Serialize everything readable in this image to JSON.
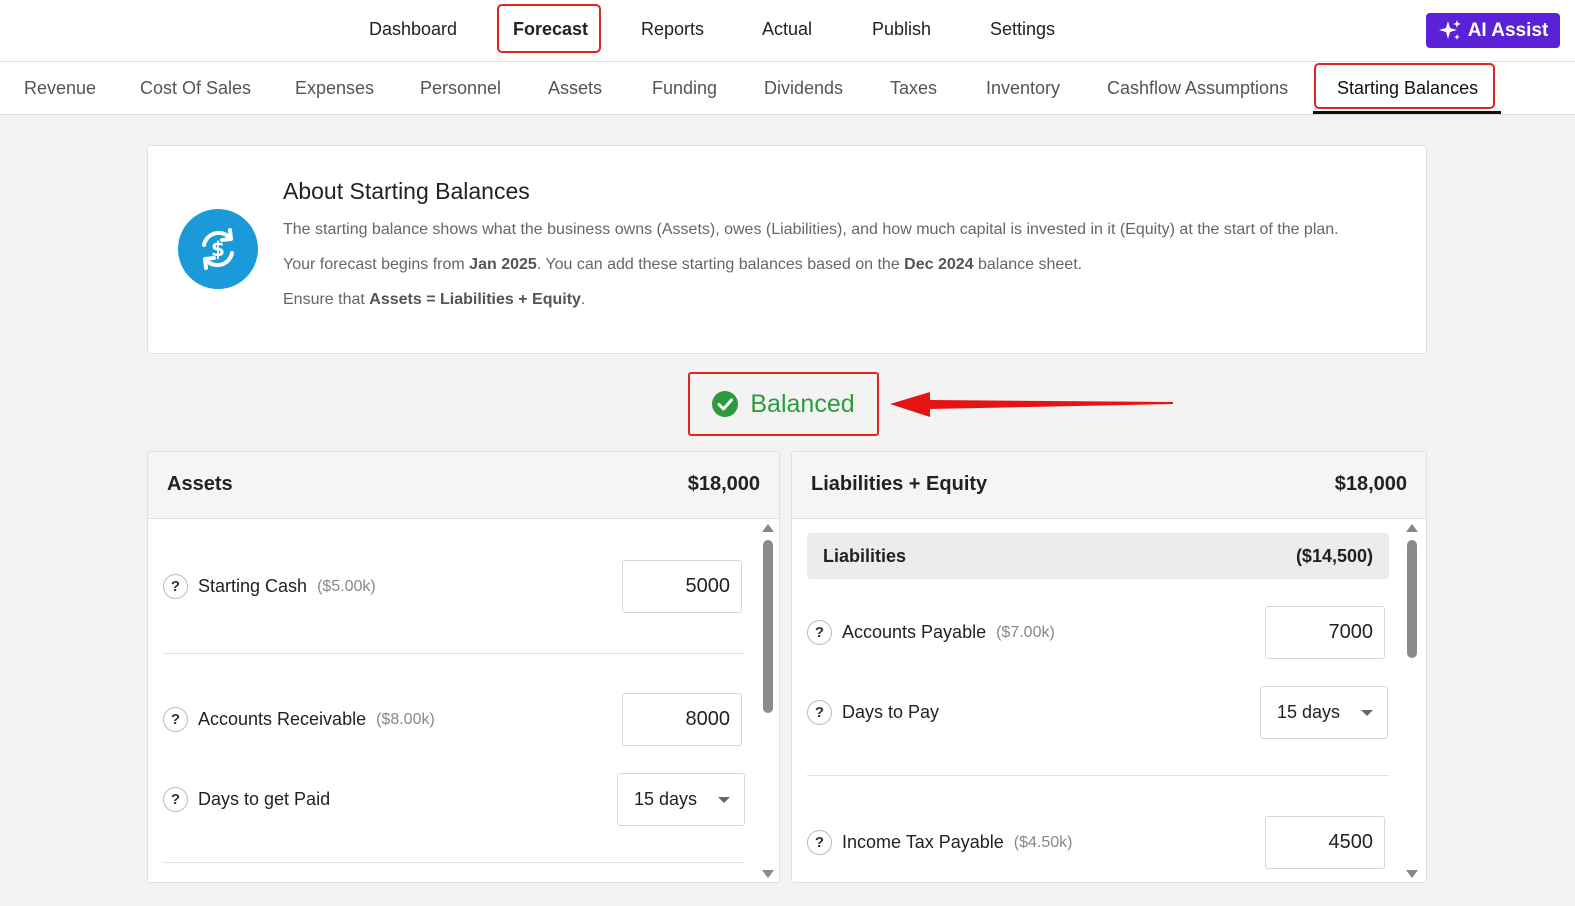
{
  "topnav": {
    "items": [
      "Dashboard",
      "Forecast",
      "Reports",
      "Actual",
      "Publish",
      "Settings"
    ],
    "active": "Forecast",
    "ai_assist_label": "AI Assist"
  },
  "subnav": {
    "items": [
      "Revenue",
      "Cost Of Sales",
      "Expenses",
      "Personnel",
      "Assets",
      "Funding",
      "Dividends",
      "Taxes",
      "Inventory",
      "Cashflow Assumptions",
      "Starting Balances"
    ],
    "active": "Starting Balances"
  },
  "about": {
    "title": "About Starting Balances",
    "line1": "The starting balance shows what the business owns (Assets), owes (Liabilities), and how much capital is invested in it (Equity) at the start of the plan.",
    "line2_pre": "Your forecast begins from ",
    "line2_date1": "Jan 2025",
    "line2_mid": ". You can add these starting balances based on the ",
    "line2_date2": "Dec 2024",
    "line2_post": " balance sheet.",
    "line3_pre": "Ensure that ",
    "line3_formula": "Assets = Liabilities + Equity",
    "line3_post": "."
  },
  "status": {
    "label": "Balanced",
    "color": "#2e9a3e"
  },
  "assets": {
    "title": "Assets",
    "total": "$18,000",
    "starting_cash": {
      "label": "Starting Cash",
      "sub": "($5.00k)",
      "value": "5000"
    },
    "accounts_receivable": {
      "label": "Accounts Receivable",
      "sub": "($8.00k)",
      "value": "8000"
    },
    "days_to_get_paid": {
      "label": "Days to get Paid",
      "value": "15 days"
    }
  },
  "liabilities_equity": {
    "title": "Liabilities + Equity",
    "total": "$18,000",
    "liabilities": {
      "title": "Liabilities",
      "total": "($14,500)"
    },
    "accounts_payable": {
      "label": "Accounts Payable",
      "sub": "($7.00k)",
      "value": "7000"
    },
    "days_to_pay": {
      "label": "Days to Pay",
      "value": "15 days"
    },
    "income_tax_payable": {
      "label": "Income Tax Payable",
      "sub": "($4.50k)",
      "value": "4500"
    }
  },
  "colors": {
    "accent": "#5b21d6",
    "highlight": "#e02424",
    "icon_blue": "#1a9ad9"
  }
}
